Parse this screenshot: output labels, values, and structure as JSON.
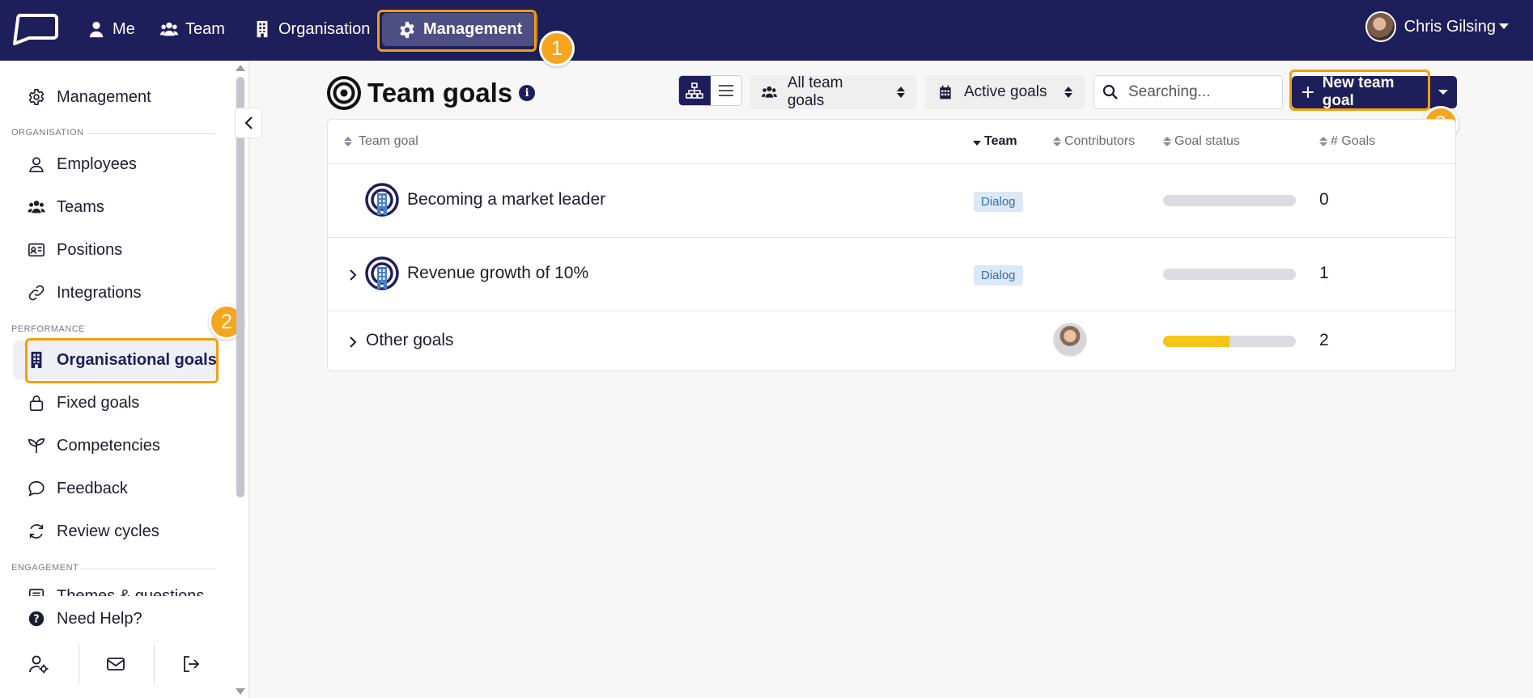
{
  "topnav": {
    "items": [
      {
        "label": "Me"
      },
      {
        "label": "Team"
      },
      {
        "label": "Organisation"
      },
      {
        "label": "Management"
      }
    ],
    "user_name": "Chris Gilsing"
  },
  "callouts": [
    "1",
    "2",
    "3"
  ],
  "sidebar": {
    "top_item": "Management",
    "sections": {
      "organisation": "ORGANISATION",
      "performance": "PERFORMANCE",
      "engagement": "ENGAGEMENT"
    },
    "organisation_items": [
      "Employees",
      "Teams",
      "Positions",
      "Integrations"
    ],
    "performance_items": [
      "Organisational goals",
      "Fixed goals",
      "Competencies",
      "Feedback",
      "Review cycles"
    ],
    "engagement_items": [
      "Themes & questions"
    ],
    "help": "Need Help?"
  },
  "main": {
    "title": "Team goals",
    "info": "i",
    "filter_team": "All team goals",
    "filter_status": "Active goals",
    "search_placeholder": "Searching...",
    "new_button": "New team goal"
  },
  "table": {
    "headers": [
      "Team goal",
      "Team",
      "Contributors",
      "Goal status",
      "# Goals"
    ],
    "rows": [
      {
        "name": "Becoming a market leader",
        "team": "Dialog",
        "progress": 0,
        "goals": "0"
      },
      {
        "name": "Revenue growth of 10%",
        "team": "Dialog",
        "progress": 0,
        "goals": "1"
      },
      {
        "name": "Other goals",
        "team": "",
        "progress": 0.5,
        "goals": "2"
      }
    ]
  },
  "colors": {
    "navy": "#1e1e5a",
    "highlight": "#f59e0b",
    "progress_fill": "#f5c518"
  }
}
